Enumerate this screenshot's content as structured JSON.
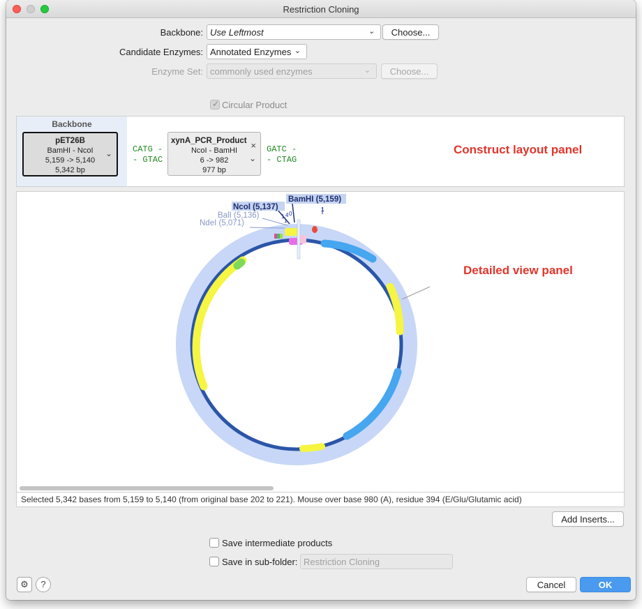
{
  "window": {
    "title": "Restriction Cloning"
  },
  "form": {
    "backbone_label": "Backbone:",
    "backbone_value": "Use Leftmost",
    "choose_label": "Choose...",
    "candidate_label": "Candidate Enzymes:",
    "candidate_value": "Annotated Enzymes",
    "enzyme_set_label": "Enzyme Set:",
    "enzyme_set_value": "commonly used enzymes",
    "enzyme_set_choose_label": "Choose...",
    "circular_product_label": "Circular Product",
    "circular_product_checked": true
  },
  "layout_panel": {
    "backbone_header": "Backbone",
    "fragments": [
      {
        "name": "pET26B",
        "enzymes": "BamHI - NcoI",
        "range": "5,159 -> 5,140",
        "length": "5,342 bp"
      },
      {
        "name": "xynA_PCR_Product",
        "enzymes": "NcoI - BamHI",
        "range": "6 -> 982",
        "length": "977 bp"
      }
    ],
    "junctions": [
      {
        "top": "CATG -",
        "bottom": "- GTAC"
      },
      {
        "top": "GATC -",
        "bottom": "- CTAG"
      }
    ]
  },
  "annotations": {
    "construct_layout": "Construct layout panel",
    "detailed_view": "Detailed view panel"
  },
  "map": {
    "sites": [
      "BamHI (5,159)",
      "NcoI (5,137)",
      "BalI (5,136)",
      "NdeI (5,071)"
    ],
    "numbers": [
      "1",
      "1",
      "4",
      "0",
      "1"
    ]
  },
  "status": "Selected 5,342 bases from 5,159 to 5,140 (from original base 202 to 221). Mouse over base 980 (A), residue 394 (E/Glu/Glutamic acid)",
  "buttons": {
    "add_inserts": "Add Inserts...",
    "cancel": "Cancel",
    "ok": "OK",
    "help": "?"
  },
  "options": {
    "save_intermediate": "Save intermediate products",
    "save_subfolder": "Save in sub-folder:",
    "subfolder_value": "Restriction Cloning"
  },
  "colors": {
    "accent": "#4a9bf0",
    "annotation": "#e2352b",
    "overhang": "#1e8a1e",
    "backbone_ring": "#2a55a8",
    "selection_ring": "#c8d7f7",
    "cds": "#f5f542",
    "feature_blue": "#46a6ef"
  }
}
